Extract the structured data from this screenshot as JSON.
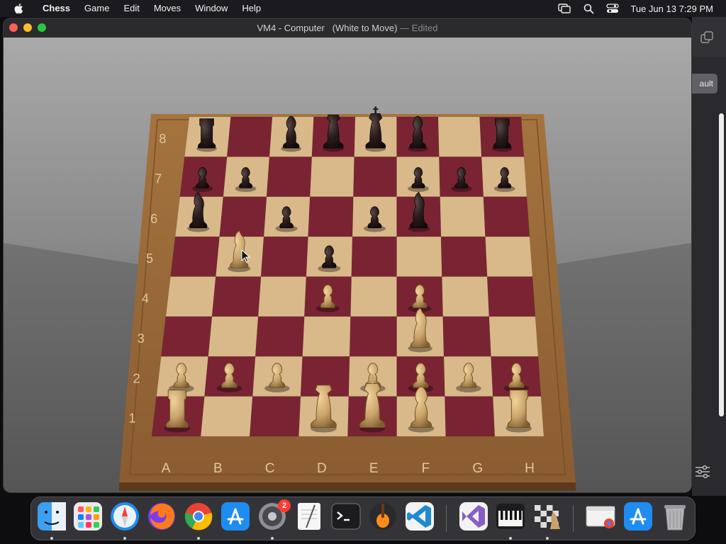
{
  "menubar": {
    "app_name": "Chess",
    "items": [
      "Game",
      "Edit",
      "Moves",
      "Window",
      "Help"
    ],
    "clock": "Tue Jun 13  7:29 PM",
    "tray_icons": [
      "screen-mirroring-icon",
      "search-icon",
      "control-center-icon"
    ]
  },
  "window": {
    "title": "VM4 - Computer   (White to Move)",
    "separator": "—",
    "status": "Edited"
  },
  "background_window": {
    "button_label": "ault"
  },
  "board": {
    "files": [
      "A",
      "B",
      "C",
      "D",
      "E",
      "F",
      "G",
      "H"
    ],
    "ranks": [
      "8",
      "7",
      "6",
      "5",
      "4",
      "3",
      "2",
      "1"
    ],
    "pieces": [
      {
        "square": "a8",
        "color": "black",
        "type": "rook"
      },
      {
        "square": "c8",
        "color": "black",
        "type": "bishop"
      },
      {
        "square": "d8",
        "color": "black",
        "type": "queen"
      },
      {
        "square": "e8",
        "color": "black",
        "type": "king"
      },
      {
        "square": "f8",
        "color": "black",
        "type": "bishop"
      },
      {
        "square": "h8",
        "color": "black",
        "type": "rook"
      },
      {
        "square": "a7",
        "color": "black",
        "type": "pawn"
      },
      {
        "square": "b7",
        "color": "black",
        "type": "pawn"
      },
      {
        "square": "f7",
        "color": "black",
        "type": "pawn"
      },
      {
        "square": "g7",
        "color": "black",
        "type": "pawn"
      },
      {
        "square": "h7",
        "color": "black",
        "type": "pawn"
      },
      {
        "square": "a6",
        "color": "black",
        "type": "knight"
      },
      {
        "square": "c6",
        "color": "black",
        "type": "pawn"
      },
      {
        "square": "e6",
        "color": "black",
        "type": "pawn"
      },
      {
        "square": "f6",
        "color": "black",
        "type": "knight"
      },
      {
        "square": "d5",
        "color": "black",
        "type": "pawn"
      },
      {
        "square": "b5",
        "color": "white",
        "type": "knight"
      },
      {
        "square": "d4",
        "color": "white",
        "type": "pawn"
      },
      {
        "square": "f4",
        "color": "white",
        "type": "pawn"
      },
      {
        "square": "f3",
        "color": "white",
        "type": "knight"
      },
      {
        "square": "a2",
        "color": "white",
        "type": "pawn"
      },
      {
        "square": "b2",
        "color": "white",
        "type": "pawn"
      },
      {
        "square": "c2",
        "color": "white",
        "type": "pawn"
      },
      {
        "square": "e2",
        "color": "white",
        "type": "pawn"
      },
      {
        "square": "f2",
        "color": "white",
        "type": "pawn"
      },
      {
        "square": "g2",
        "color": "white",
        "type": "pawn"
      },
      {
        "square": "h2",
        "color": "white",
        "type": "pawn"
      },
      {
        "square": "a1",
        "color": "white",
        "type": "rook"
      },
      {
        "square": "d1",
        "color": "white",
        "type": "queen"
      },
      {
        "square": "e1",
        "color": "white",
        "type": "king"
      },
      {
        "square": "f1",
        "color": "white",
        "type": "bishop"
      },
      {
        "square": "h1",
        "color": "white",
        "type": "rook"
      }
    ],
    "colors": {
      "light": "#d9b98a",
      "dark": "#7a2433",
      "frame": "#9a6a3c",
      "black_piece": "#2a1c1c",
      "white_piece": "#c9a36a"
    }
  },
  "dock": {
    "items": [
      {
        "name": "finder-icon",
        "running": true
      },
      {
        "name": "launchpad-icon",
        "running": false
      },
      {
        "name": "safari-icon",
        "running": true
      },
      {
        "name": "firefox-icon",
        "running": false
      },
      {
        "name": "chrome-icon",
        "running": true
      },
      {
        "name": "app-store-icon",
        "running": false
      },
      {
        "name": "system-settings-icon",
        "running": true,
        "badge": "2"
      },
      {
        "name": "textedit-icon",
        "running": false
      },
      {
        "name": "terminal-icon",
        "running": false
      },
      {
        "name": "garageband-icon",
        "running": false
      },
      {
        "name": "vscode-icon",
        "running": false
      },
      {
        "name": "visual-studio-icon",
        "running": false
      },
      {
        "name": "piano-icon",
        "running": true
      },
      {
        "name": "chess-icon",
        "running": true
      },
      {
        "name": "chrome-window-icon",
        "running": false
      },
      {
        "name": "app-store-downloads-icon",
        "running": false
      },
      {
        "name": "trash-icon",
        "running": false
      }
    ]
  }
}
